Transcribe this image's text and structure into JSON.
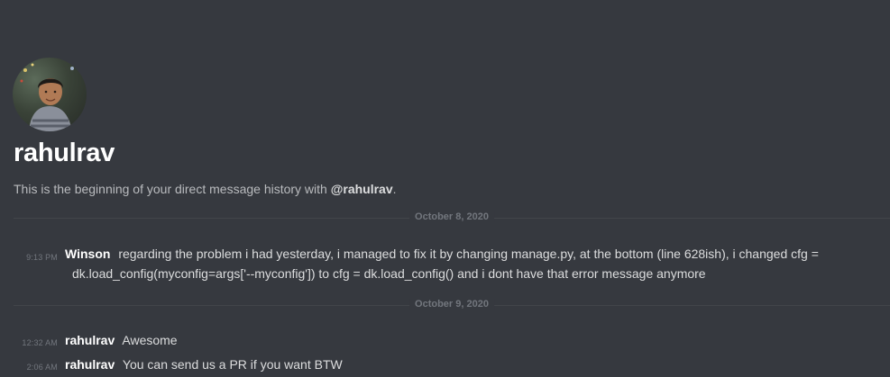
{
  "profile": {
    "username": "rahulrav",
    "intro_prefix": "This is the beginning of your direct message history with ",
    "intro_handle": "@rahulrav",
    "intro_suffix": "."
  },
  "dividers": [
    {
      "label": "October 8, 2020"
    },
    {
      "label": "October 9, 2020"
    }
  ],
  "messages": [
    {
      "time": "9:13 PM",
      "author": "Winson",
      "text_line1": "regarding the problem i had yesterday, i managed to fix it by changing manage.py, at the bottom (line 628ish), i changed cfg =",
      "text_line2": "dk.load_config(myconfig=args['--myconfig']) to cfg = dk.load_config() and i dont have that error message anymore"
    },
    {
      "time": "12:32 AM",
      "author": "rahulrav",
      "text": "Awesome"
    },
    {
      "time": "2:06 AM",
      "author": "rahulrav",
      "text": "You can send us a PR if you want BTW"
    }
  ]
}
